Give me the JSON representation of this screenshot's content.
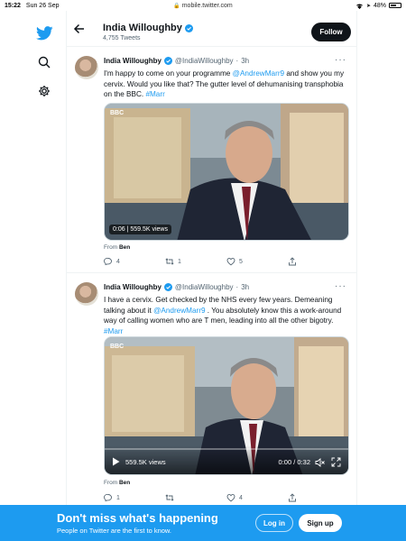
{
  "status_bar": {
    "time": "15:22",
    "date": "Sun 26 Sep",
    "url": "mobile.twitter.com",
    "battery": "48%",
    "battery_level": 0.48
  },
  "header": {
    "name": "India Willoughby",
    "tweet_count": "4,755 Tweets",
    "follow_label": "Follow"
  },
  "tweets": [
    {
      "author": "India Willoughby",
      "handle": "@IndiaWilloughby",
      "dot": "·",
      "time": "3h",
      "text_1": "I'm happy to come on your programme ",
      "mention": "@AndrewMarr9",
      "text_2": " and show you my cervix. Would you like that? The gutter level of dehumanising transphobia on the BBC. ",
      "hashtag": "#Marr",
      "video_duration": "0:06",
      "video_sep": " | ",
      "video_views": "559.5K views",
      "from_label": "From",
      "from_name": "Ben",
      "replies": "4",
      "retweets": "1",
      "likes": "5"
    },
    {
      "author": "India Willoughby",
      "handle": "@IndiaWilloughby",
      "dot": "·",
      "time": "3h",
      "text_1": "I have a cervix. Get checked by the NHS every few years. Demeaning talking about it ",
      "mention": "@AndrewMarr9",
      "text_2": " . You  absolutely know this a work-around way of calling women who are T men, leading into all the other bigotry. ",
      "hashtag": "#Marr",
      "video_views": "559.5K views",
      "video_time": "0:00 / 0:32",
      "from_label": "From",
      "from_name": "Ben",
      "replies": "1",
      "retweets": "",
      "likes": "4"
    }
  ],
  "banner": {
    "title": "Don't miss what's happening",
    "subtitle": "People on Twitter are the first to know.",
    "login_label": "Log in",
    "signup_label": "Sign up"
  },
  "colors": {
    "accent": "#1d9bf0",
    "text": "#0f1419",
    "muted": "#536471"
  }
}
